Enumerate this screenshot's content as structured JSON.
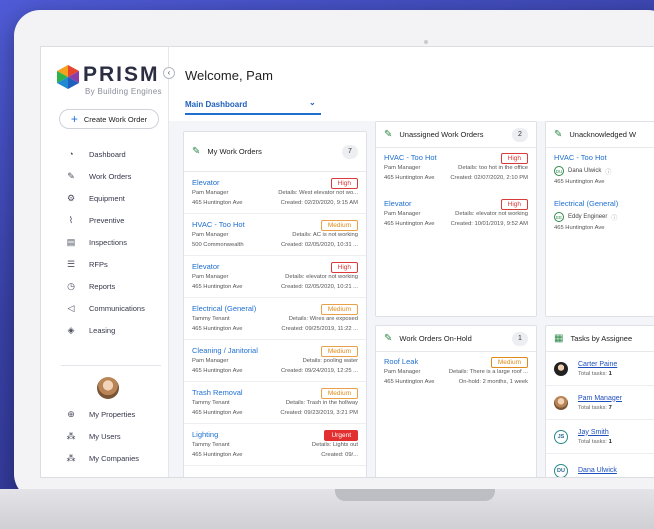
{
  "brand": {
    "name": "PRISM",
    "tagline": "By Building Engines"
  },
  "sidebar": {
    "create_label": "Create Work Order",
    "items": [
      {
        "label": "Dashboard",
        "icon": "dashboard-icon"
      },
      {
        "label": "Work Orders",
        "icon": "wrench-icon"
      },
      {
        "label": "Equipment",
        "icon": "gears-icon"
      },
      {
        "label": "Preventive",
        "icon": "preventive-icon"
      },
      {
        "label": "Inspections",
        "icon": "clipboard-icon"
      },
      {
        "label": "RFPs",
        "icon": "list-icon"
      },
      {
        "label": "Reports",
        "icon": "reports-icon"
      },
      {
        "label": "Communications",
        "icon": "megaphone-icon"
      },
      {
        "label": "Leasing",
        "icon": "layers-icon"
      }
    ],
    "bottom_items": [
      {
        "label": "My Properties",
        "icon": "globe-icon"
      },
      {
        "label": "My Users",
        "icon": "users-icon"
      },
      {
        "label": "My Companies",
        "icon": "companies-icon"
      }
    ]
  },
  "header": {
    "welcome": "Welcome, Pam",
    "tab": "Main Dashboard"
  },
  "my_work_orders": {
    "title": "My Work Orders",
    "count": "7",
    "items": [
      {
        "title": "Elevator",
        "priority": "High",
        "level": "high",
        "person": "Pam Manager",
        "details": "Details: West elevator not wo...",
        "address": "465 Huntington Ave",
        "created": "Created: 02/20/2020, 9:15 AM"
      },
      {
        "title": "HVAC - Too Hot",
        "priority": "Medium",
        "level": "medium",
        "person": "Pam Manager",
        "details": "Details: AC is not working",
        "address": "500 Commonwealth",
        "created": "Created: 02/05/2020, 10:31 ..."
      },
      {
        "title": "Elevator",
        "priority": "High",
        "level": "high",
        "person": "Pam Manager",
        "details": "Details: elevator not working",
        "address": "465 Huntington Ave",
        "created": "Created: 02/05/2020, 10:21 ..."
      },
      {
        "title": "Electrical (General)",
        "priority": "Medium",
        "level": "medium",
        "person": "Tammy Tenant",
        "details": "Details: Wires are exposed",
        "address": "465 Huntington Ave",
        "created": "Created: 09/25/2019, 11:22 ..."
      },
      {
        "title": "Cleaning / Janitorial",
        "priority": "Medium",
        "level": "medium",
        "person": "Pam Manager",
        "details": "Details: pooling water",
        "address": "465 Huntington Ave",
        "created": "Created: 09/24/2019, 12:25 ..."
      },
      {
        "title": "Trash Removal",
        "priority": "Medium",
        "level": "medium",
        "person": "Tammy Tenant",
        "details": "Details: Trash in the hollway",
        "address": "465 Huntington Ave",
        "created": "Created: 09/23/2019, 3:21 PM"
      },
      {
        "title": "Lighting",
        "priority": "Urgent",
        "level": "urgent",
        "person": "Tammy Tenant",
        "details": "Details: Lights out",
        "address": "465 Huntington Ave",
        "created": "Created: 09/..."
      }
    ]
  },
  "unassigned": {
    "title": "Unassigned Work Orders",
    "count": "2",
    "items": [
      {
        "title": "HVAC - Too Hot",
        "priority": "High",
        "level": "high",
        "person": "Pam Manager",
        "details": "Details: too hot in the office",
        "address": "465 Huntington Ave",
        "created": "Created: 02/07/2020, 2:10 PM"
      },
      {
        "title": "Elevator",
        "priority": "High",
        "level": "high",
        "person": "Pam Manager",
        "details": "Details: elevator not working",
        "address": "465 Huntington Ave",
        "created": "Created: 10/01/2019, 9:52 AM"
      }
    ]
  },
  "unacknowledged": {
    "title": "Unacknowledged W",
    "items": [
      {
        "title": "HVAC - Too Hot",
        "initials": "DU",
        "person": "Dana Ulwick",
        "address": "465 Huntington Ave"
      },
      {
        "title": "Electrical (General)",
        "initials": "EE",
        "person": "Eddy Engineer",
        "address": "465 Huntington Ave"
      }
    ]
  },
  "on_hold": {
    "title": "Work Orders On-Hold",
    "count": "1",
    "items": [
      {
        "title": "Roof Leak",
        "priority": "Medium",
        "level": "medium",
        "person": "Pam Manager",
        "details": "Details: There is a large roof ...",
        "address": "465 Huntington Ave",
        "created": "On-hold: 2 months, 1 week"
      }
    ]
  },
  "tasks": {
    "title": "Tasks by Assignee",
    "total_label": "Total tasks:",
    "items": [
      {
        "name": "Carter Paine",
        "tasks": "1",
        "avatar": "img1",
        "initials": ""
      },
      {
        "name": "Pam Manager",
        "tasks": "7",
        "avatar": "img2",
        "initials": ""
      },
      {
        "name": "Jay Smith",
        "tasks": "1",
        "avatar": "ini",
        "initials": "JS"
      },
      {
        "name": "Dana Ulwick",
        "tasks": "",
        "avatar": "ini",
        "initials": "DU"
      }
    ]
  },
  "colors": {
    "accent": "#1f6fd1",
    "high": "#d93a3a",
    "medium": "#e08a1a",
    "urgent": "#e23030",
    "icon_green": "#2f8a4a"
  }
}
